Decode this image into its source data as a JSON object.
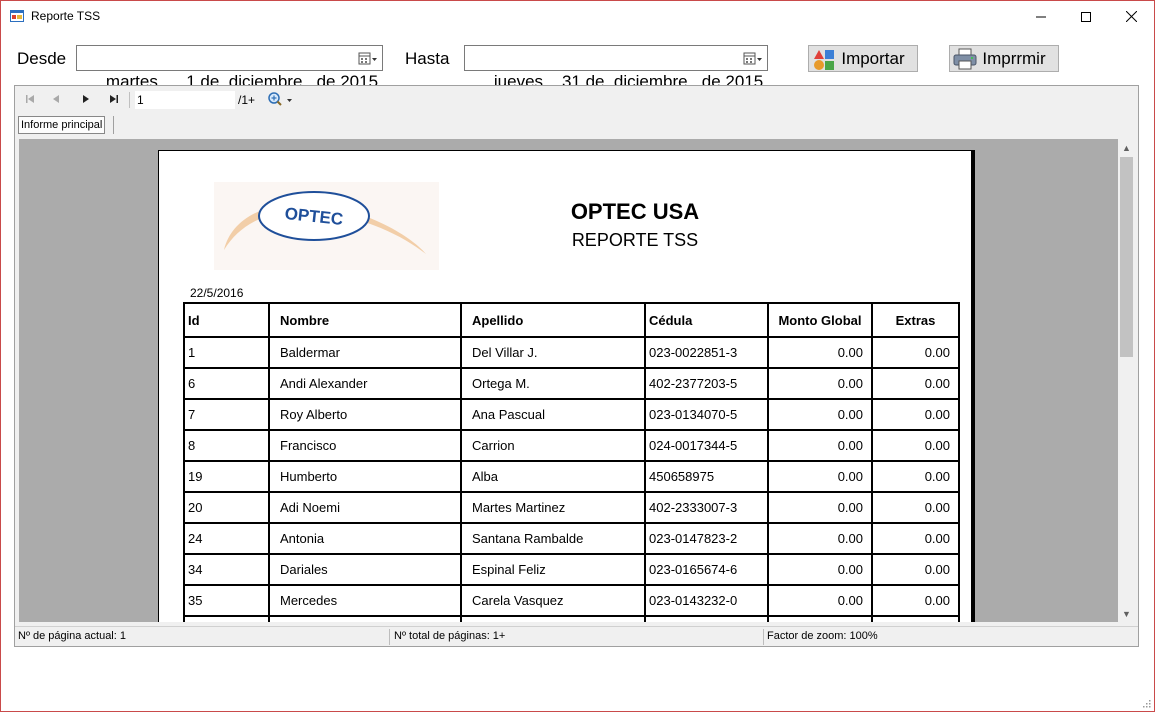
{
  "window": {
    "title": "Reporte TSS"
  },
  "filters": {
    "desde_label": "Desde",
    "desde_value": "martes  ,   1 de  diciembre   de 2015",
    "hasta_label": "Hasta",
    "hasta_value": "jueves  , 31 de  diciembre   de 2015"
  },
  "buttons": {
    "importar": "Importar",
    "imprimir": "Imprrmir"
  },
  "viewer": {
    "page_input": "1",
    "page_total": "/1+",
    "tab_label": "Informe principal",
    "status": {
      "current_page": "Nº de página actual: 1",
      "total_pages": "Nº total de páginas: 1+",
      "zoom": "Factor de zoom: 100%"
    }
  },
  "report": {
    "logo_text": "OPTEC",
    "company": "OPTEC USA",
    "subtitle": "REPORTE TSS",
    "date": "22/5/2016",
    "columns": [
      "Id",
      "Nombre",
      "Apellido",
      "Cédula",
      "Monto Global",
      "Extras"
    ],
    "rows": [
      [
        "1",
        "Baldermar",
        "Del Villar J.",
        "023-0022851-3",
        "0.00",
        "0.00"
      ],
      [
        "6",
        "Andi Alexander",
        "Ortega M.",
        "402-2377203-5",
        "0.00",
        "0.00"
      ],
      [
        "7",
        "Roy Alberto",
        "Ana Pascual",
        "023-0134070-5",
        "0.00",
        "0.00"
      ],
      [
        "8",
        "Francisco",
        "Carrion",
        "024-0017344-5",
        "0.00",
        "0.00"
      ],
      [
        "19",
        "Humberto",
        "Alba",
        "450658975",
        "0.00",
        "0.00"
      ],
      [
        "20",
        "Adi Noemi",
        "Martes Martinez",
        "402-2333007-3",
        "0.00",
        "0.00"
      ],
      [
        "24",
        "Antonia",
        "Santana Rambalde",
        "023-0147823-2",
        "0.00",
        "0.00"
      ],
      [
        "34",
        "Dariales",
        "Espinal Feliz",
        "023-0165674-6",
        "0.00",
        "0.00"
      ],
      [
        "35",
        "Mercedes",
        "Carela Vasquez",
        "023-0143232-0",
        "0.00",
        "0.00"
      ]
    ]
  }
}
